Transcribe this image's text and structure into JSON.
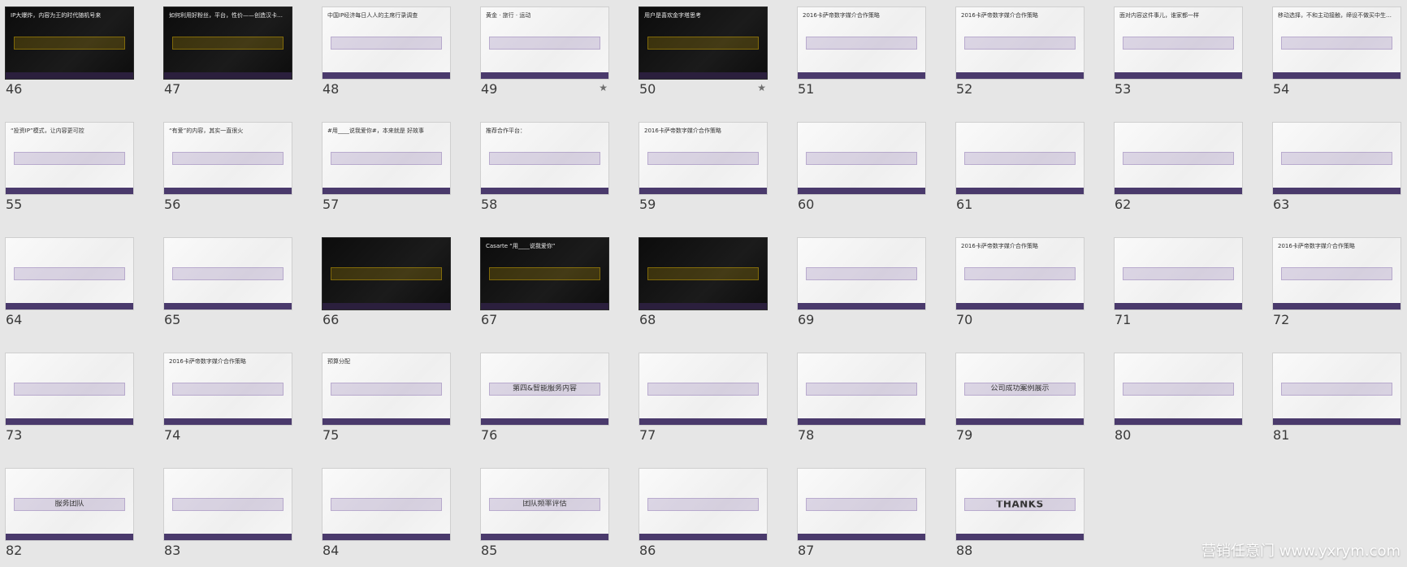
{
  "slides": [
    {
      "number": "46",
      "title": "IP大爆炸，内容为王的时代随机号来",
      "star": false,
      "theme": "dark"
    },
    {
      "number": "47",
      "title": "如何利用好粉丝，平台，性价——创造汉卡格里后方在中国可能的",
      "star": false,
      "theme": "dark"
    },
    {
      "number": "48",
      "title": "中国IP经济每日人人的主席行录调查",
      "star": false,
      "theme": "light"
    },
    {
      "number": "49",
      "title": "黄金 · 旅行 · 运动",
      "star": true,
      "theme": "light"
    },
    {
      "number": "50",
      "title": "用户是喜欢金字塔思考",
      "star": true,
      "theme": "dark"
    },
    {
      "number": "51",
      "title": "2016卡萨帝数字媒介合作策略",
      "star": false,
      "theme": "light"
    },
    {
      "number": "52",
      "title": "2016卡萨帝数字媒介合作策略",
      "star": false,
      "theme": "light"
    },
    {
      "number": "53",
      "title": "面对内容这件事儿，谁家都一样",
      "star": false,
      "theme": "light"
    },
    {
      "number": "54",
      "title": "移动选择，不和主动接触，缔设不做买中生有？",
      "star": false,
      "theme": "light"
    },
    {
      "number": "55",
      "title": "“投资IP”模式，让内容更可控",
      "star": false,
      "theme": "light"
    },
    {
      "number": "56",
      "title": "“有爱”的内容，其实一直很火",
      "star": false,
      "theme": "light"
    },
    {
      "number": "57",
      "title": "#用____说我爱你#，本来就是 好故事",
      "star": false,
      "theme": "light"
    },
    {
      "number": "58",
      "title": "推荐合作平台：",
      "star": false,
      "theme": "light"
    },
    {
      "number": "59",
      "title": "2016卡萨帝数字媒介合作策略",
      "star": false,
      "theme": "light"
    },
    {
      "number": "60",
      "title": "",
      "star": false,
      "theme": "light"
    },
    {
      "number": "61",
      "title": "",
      "star": false,
      "theme": "light"
    },
    {
      "number": "62",
      "title": "",
      "star": false,
      "theme": "light"
    },
    {
      "number": "63",
      "title": "",
      "star": false,
      "theme": "light"
    },
    {
      "number": "64",
      "title": "",
      "star": false,
      "theme": "light"
    },
    {
      "number": "65",
      "title": "",
      "star": false,
      "theme": "light"
    },
    {
      "number": "66",
      "title": "",
      "star": false,
      "theme": "dark"
    },
    {
      "number": "67",
      "title": "Casarte “用____说我爱你”",
      "star": false,
      "theme": "dark"
    },
    {
      "number": "68",
      "title": "",
      "star": false,
      "theme": "dark"
    },
    {
      "number": "69",
      "title": "",
      "star": false,
      "theme": "light"
    },
    {
      "number": "70",
      "title": "2016卡萨帝数字媒介合作策略",
      "star": false,
      "theme": "light"
    },
    {
      "number": "71",
      "title": "",
      "star": false,
      "theme": "light"
    },
    {
      "number": "72",
      "title": "2016卡萨帝数字媒介合作策略",
      "star": false,
      "theme": "light"
    },
    {
      "number": "73",
      "title": "",
      "star": false,
      "theme": "light"
    },
    {
      "number": "74",
      "title": "2016卡萨帝数字媒介合作策略",
      "star": false,
      "theme": "light"
    },
    {
      "number": "75",
      "title": "预算分配",
      "star": false,
      "theme": "light"
    },
    {
      "number": "76",
      "title": "第四&智能服务内容",
      "star": false,
      "theme": "light"
    },
    {
      "number": "77",
      "title": "",
      "star": false,
      "theme": "light"
    },
    {
      "number": "78",
      "title": "",
      "star": false,
      "theme": "light"
    },
    {
      "number": "79",
      "title": "公司成功案例展示",
      "star": false,
      "theme": "light"
    },
    {
      "number": "80",
      "title": "",
      "star": false,
      "theme": "light"
    },
    {
      "number": "81",
      "title": "",
      "star": false,
      "theme": "light"
    },
    {
      "number": "82",
      "title": "服务团队",
      "star": false,
      "theme": "light"
    },
    {
      "number": "83",
      "title": "",
      "star": false,
      "theme": "light"
    },
    {
      "number": "84",
      "title": "",
      "star": false,
      "theme": "light"
    },
    {
      "number": "85",
      "title": "团队频率评估",
      "star": false,
      "theme": "light"
    },
    {
      "number": "86",
      "title": "",
      "star": false,
      "theme": "light"
    },
    {
      "number": "87",
      "title": "",
      "star": false,
      "theme": "light"
    },
    {
      "number": "88",
      "title": "THANKS",
      "star": false,
      "theme": "light"
    }
  ],
  "watermark": "营销任意门 www.yxrym.com",
  "colors": {
    "background": "#e6e6e6",
    "accent_purple": "#7a5fa5",
    "footer_purple": "#4a3a6c",
    "label_text": "#3a3a3a"
  }
}
